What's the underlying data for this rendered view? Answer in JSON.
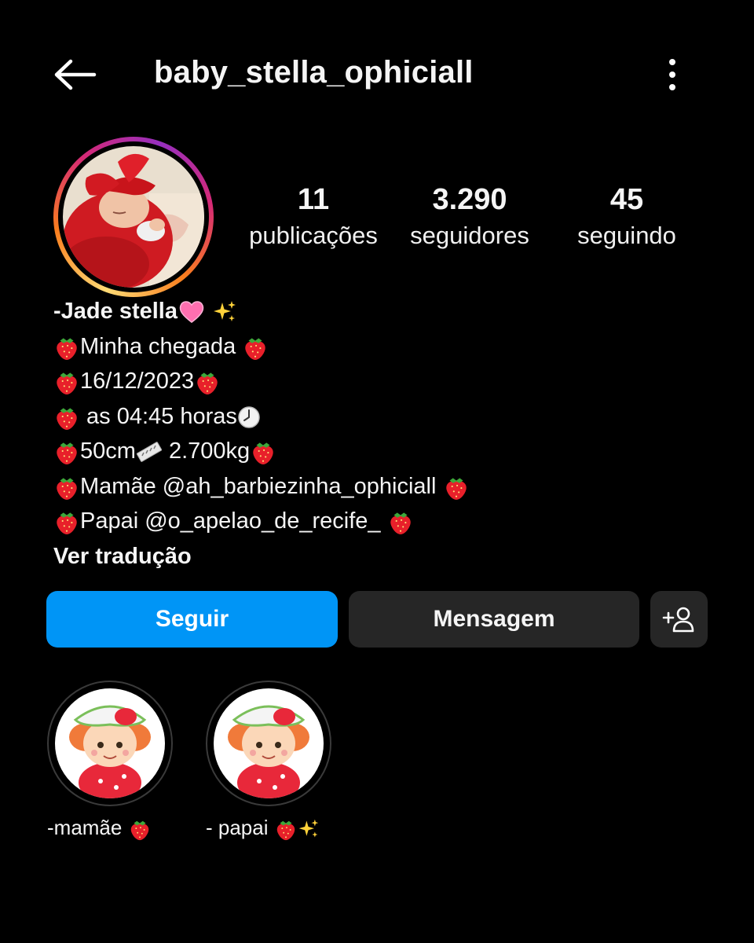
{
  "header": {
    "username": "baby_stella_ophiciall",
    "back_icon": "arrow-left-icon",
    "more_icon": "vertical-dots-icon"
  },
  "profile": {
    "stats": [
      {
        "value": "11",
        "label": "publicações"
      },
      {
        "value": "3.290",
        "label": "seguidores"
      },
      {
        "value": "45",
        "label": "seguindo"
      }
    ]
  },
  "bio": {
    "name": "-Jade stella",
    "lines": [
      {
        "before": "",
        "text": "Minha chegada ",
        "after": "strawberry"
      },
      {
        "before": "",
        "text": "16/12/2023",
        "after": "strawberry"
      },
      {
        "before": "",
        "text": " as 04:45 horas",
        "after": "clock"
      },
      {
        "before": "",
        "text": "50cm",
        "after": "ruler"
      },
      {
        "before": "",
        "text": "Mamãe @ah_barbiezinha_ophiciall ",
        "after": "strawberry"
      },
      {
        "before": "",
        "text": "Papai @o_apelao_de_recife_ ",
        "after": "strawberry"
      }
    ],
    "weight": " 2.700kg",
    "translate": "Ver tradução"
  },
  "actions": {
    "follow": "Seguir",
    "message": "Mensagem",
    "add_user_icon": "add-person-icon"
  },
  "highlights": [
    {
      "label": "-mamãe "
    },
    {
      "label": "- papai "
    }
  ],
  "colors": {
    "background": "#000000",
    "follow_button": "#0095f6",
    "secondary_button": "#262626",
    "text": "#f5f5f5"
  }
}
